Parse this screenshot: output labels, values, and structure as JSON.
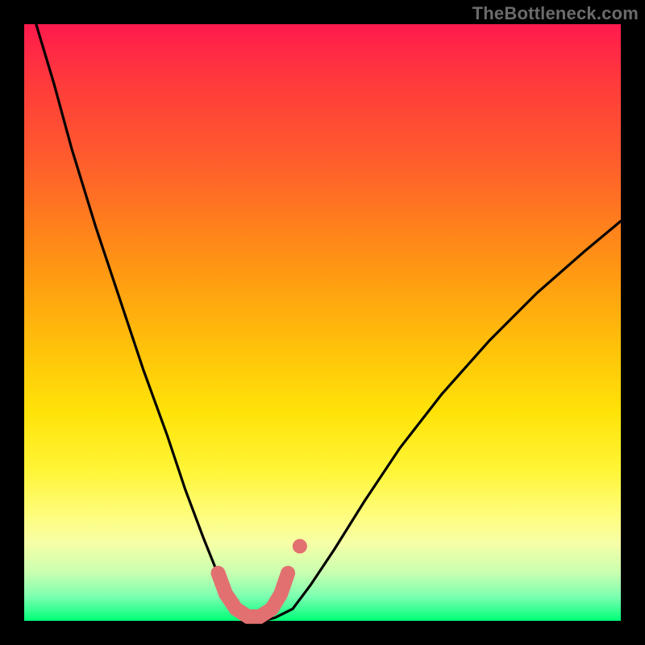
{
  "watermark": "TheBottleneck.com",
  "colors": {
    "background": "#000000",
    "curve": "#000000",
    "marker": "#e27070",
    "gradient_top": "#ff1a4d",
    "gradient_bottom": "#00ff77"
  },
  "chart_data": {
    "type": "line",
    "title": "",
    "xlabel": "",
    "ylabel": "",
    "xlim": [
      0,
      100
    ],
    "ylim": [
      0,
      100
    ],
    "series": [
      {
        "name": "bottleneck-curve",
        "x": [
          2,
          5,
          8,
          12,
          16,
          20,
          24,
          27,
          30,
          32,
          34,
          36,
          38,
          40,
          42,
          45,
          48,
          52,
          57,
          63,
          70,
          78,
          86,
          94,
          100
        ],
        "y": [
          100,
          90,
          79,
          66,
          54,
          42,
          31,
          22,
          14,
          9,
          5,
          2,
          0.5,
          0,
          0.5,
          2,
          6,
          12,
          20,
          29,
          38,
          47,
          55,
          62,
          67
        ]
      }
    ],
    "markers": {
      "name": "highlight-band",
      "x": [
        32.5,
        33.8,
        35.5,
        37.5,
        39.5,
        41.5,
        43.0,
        44.2
      ],
      "y": [
        8.0,
        4.5,
        2.0,
        0.7,
        0.7,
        2.0,
        4.5,
        8.0
      ],
      "extra_dot": {
        "x": 46.2,
        "y": 12.5
      }
    }
  }
}
